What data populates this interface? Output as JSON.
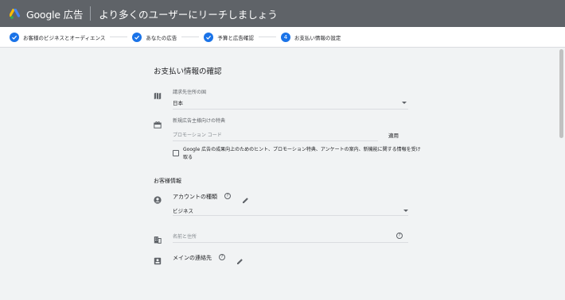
{
  "header": {
    "brand": "Google 広告",
    "title": "より多くのユーザーにリーチしましょう"
  },
  "steps": [
    {
      "label": "お客様のビジネスとオーディエンス",
      "state": "done"
    },
    {
      "label": "あなたの広告",
      "state": "done"
    },
    {
      "label": "予算と広告確認",
      "state": "done"
    },
    {
      "label": "お支払い情報の設定",
      "state": "current",
      "number": "4"
    }
  ],
  "payment": {
    "title": "お支払い情報の確認",
    "country_label": "請求先住所の国",
    "country_value": "日本",
    "promo_label": "新規広告主様向けの特典",
    "promo_placeholder": "プロモーション コード",
    "apply_label": "適用",
    "checkbox_text": "Google 広告の成果向上のためのヒント、プロモーション特典、アンケートの案内、新機能に関する情報を受け取る"
  },
  "customer": {
    "heading": "お客様情報",
    "account_type_label": "アカウントの種類",
    "account_type_value": "ビジネス",
    "name_address_placeholder": "名前と住所",
    "main_contact_label": "メインの連絡先",
    "help_glyph": "?"
  },
  "colors": {
    "header_bg": "#5f6368",
    "accent": "#1a73e8",
    "page_bg": "#f1f3f4"
  }
}
